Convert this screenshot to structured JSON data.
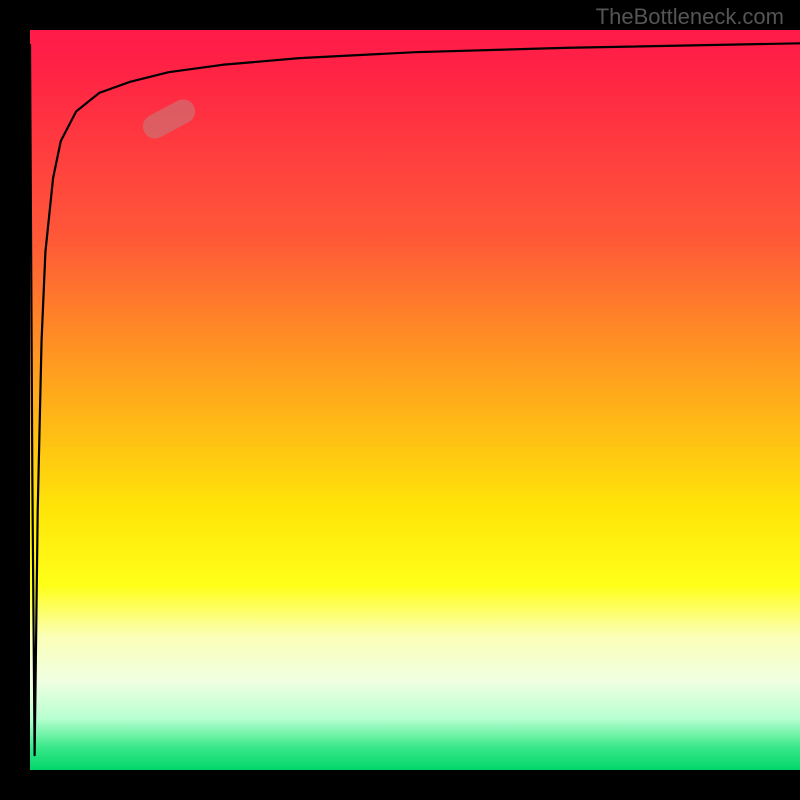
{
  "watermark": "TheBottleneck.com",
  "colors": {
    "gradient_top": "#ff1a4a",
    "gradient_mid1": "#ff9a20",
    "gradient_mid2": "#ffff18",
    "gradient_bottom": "#00d66a",
    "curve": "#000000",
    "marker": "rgba(200,120,120,0.62)",
    "frame": "#000000"
  },
  "chart_data": {
    "type": "line",
    "title": "",
    "xlabel": "",
    "ylabel": "",
    "xlim": [
      0,
      100
    ],
    "ylim": [
      0,
      100
    ],
    "grid": false,
    "series": [
      {
        "name": "bottleneck-curve",
        "description": "V-shaped then log-like curve: near x=0 it drops from the top to ~0, then rises steeply and asymptotically approaches the top toward the right edge.",
        "x": [
          0,
          0.3,
          0.6,
          1.0,
          1.5,
          2,
          3,
          4,
          6,
          9,
          13,
          18,
          25,
          35,
          50,
          70,
          100
        ],
        "y": [
          98,
          40,
          2,
          35,
          58,
          70,
          80,
          85,
          89,
          91.5,
          93,
          94.3,
          95.3,
          96.2,
          97,
          97.6,
          98.2
        ]
      }
    ],
    "marker": {
      "name": "highlight-segment",
      "x_center": 18,
      "y_center": 88,
      "rotation_deg": -28
    },
    "legend": false
  }
}
